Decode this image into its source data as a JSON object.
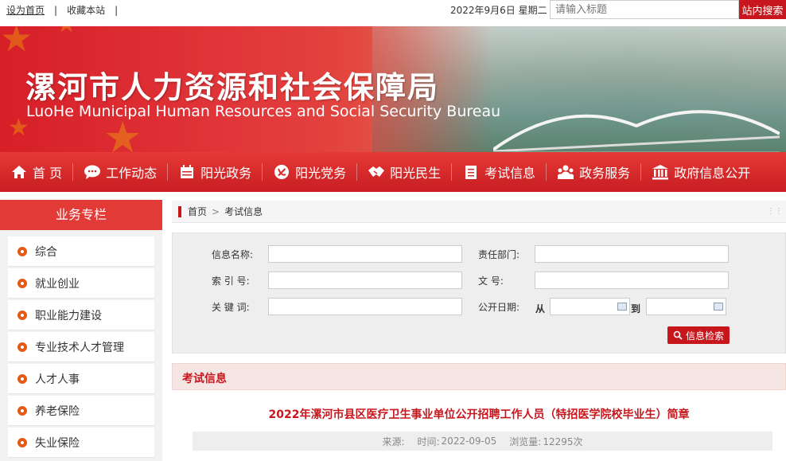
{
  "topbar": {
    "set_home": "设为首页",
    "bookmark": "收藏本站",
    "date": "2022年9月6日 星期二",
    "search_placeholder": "请输入标题",
    "search_button": "站内搜索"
  },
  "banner": {
    "title": "漯河市人力资源和社会保障局",
    "subtitle": "LuoHe Municipal Human Resources and Social Security Bureau"
  },
  "nav": [
    {
      "label": "首 页",
      "icon": "home-icon"
    },
    {
      "label": "工作动态",
      "icon": "chat-icon"
    },
    {
      "label": "阳光政务",
      "icon": "calendar-icon"
    },
    {
      "label": "阳光党务",
      "icon": "party-emblem-icon"
    },
    {
      "label": "阳光民生",
      "icon": "handshake-icon"
    },
    {
      "label": "考试信息",
      "icon": "document-icon"
    },
    {
      "label": "政务服务",
      "icon": "people-icon"
    },
    {
      "label": "政府信息公开",
      "icon": "government-building-icon"
    }
  ],
  "sidebar": {
    "title": "业务专栏",
    "items": [
      "综合",
      "就业创业",
      "职业能力建设",
      "专业技术人才管理",
      "人才人事",
      "养老保险",
      "失业保险"
    ]
  },
  "breadcrumb": {
    "home": "首页",
    "separator": ">",
    "current": "考试信息"
  },
  "search_form": {
    "info_name_label": "信息名称:",
    "department_label": "责任部门:",
    "index_label": "索 引 号:",
    "doc_no_label": "文 号:",
    "keyword_label": "关 键 词:",
    "date_label": "公开日期:",
    "from_label": "从",
    "to_label": "到",
    "submit": "信息检索"
  },
  "section": {
    "title": "考试信息"
  },
  "article": {
    "title": "2022年漯河市县区医疗卫生事业单位公开招聘工作人员（特招医学院校毕业生）简章",
    "source_label": "来源:",
    "time_label": "时间:",
    "time": "2022-09-05",
    "views_label": "浏览量:",
    "views": "12295次"
  },
  "colors": {
    "brand_red": "#c8161d",
    "nav_red": "#e53a36"
  }
}
